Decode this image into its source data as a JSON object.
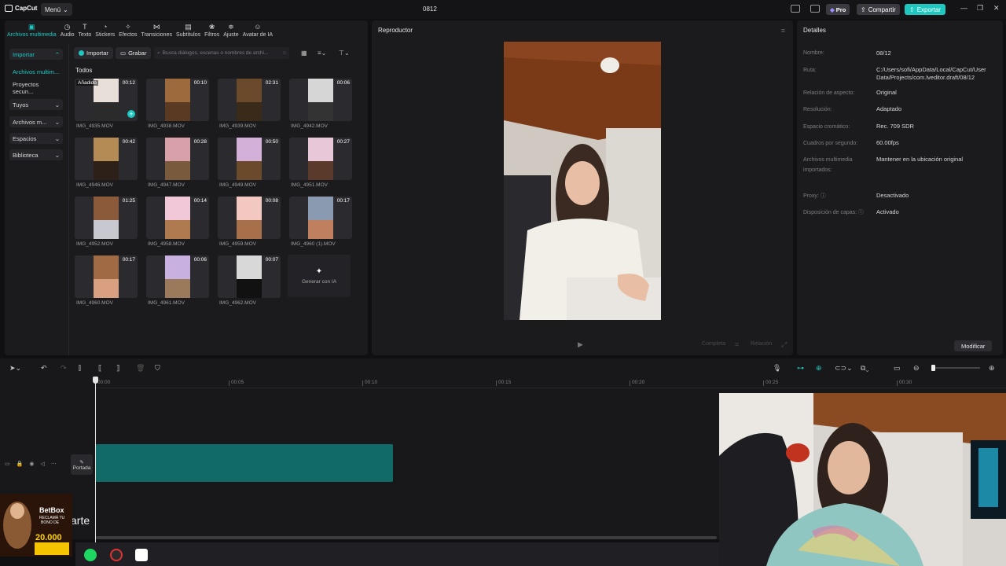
{
  "app": {
    "logo_text": "CapCut",
    "menu_label": "Menú",
    "project_title": "0812",
    "pro_label": "Pro",
    "share_label": "Compartir",
    "export_label": "Exportar"
  },
  "tool_tabs": [
    {
      "label": "Archivos multimedia",
      "icon": "media-icon",
      "glyph": "▣"
    },
    {
      "label": "Audio",
      "icon": "audio-icon",
      "glyph": "◷"
    },
    {
      "label": "Texto",
      "icon": "text-icon",
      "glyph": "T"
    },
    {
      "label": "Stickers",
      "icon": "sticker-icon",
      "glyph": "◔"
    },
    {
      "label": "Efectos",
      "icon": "effects-icon",
      "glyph": "✧"
    },
    {
      "label": "Transiciones",
      "icon": "transition-icon",
      "glyph": "⋈"
    },
    {
      "label": "Subtítulos",
      "icon": "subtitles-icon",
      "glyph": "▤"
    },
    {
      "label": "Filtros",
      "icon": "filters-icon",
      "glyph": "❀"
    },
    {
      "label": "Ajuste",
      "icon": "adjust-icon",
      "glyph": "≑"
    },
    {
      "label": "Avatar de IA",
      "icon": "avatar-icon",
      "glyph": "☺"
    }
  ],
  "sidebar": {
    "items": [
      {
        "label": "Importar"
      },
      {
        "label": "Archivos multim..."
      },
      {
        "label": "Proyectos secun..."
      },
      {
        "label": "Tuyos"
      },
      {
        "label": "Archivos m..."
      },
      {
        "label": "Espacios"
      },
      {
        "label": "Biblioteca"
      }
    ]
  },
  "media_toolbar": {
    "import_label": "Importar",
    "record_label": "Grabar",
    "search_placeholder": "Busca diálogos, escenas o nombres de archi..."
  },
  "all_label": "Todos",
  "added_label": "Añadido",
  "media_items": [
    {
      "name": "IMG_4935.MOV",
      "duration": "00:12"
    },
    {
      "name": "IMG_4938.MOV",
      "duration": "00:10"
    },
    {
      "name": "IMG_4939.MOV",
      "duration": "02:31"
    },
    {
      "name": "IMG_4942.MOV",
      "duration": "00:06"
    },
    {
      "name": "IMG_4946.MOV",
      "duration": "00:42"
    },
    {
      "name": "IMG_4947.MOV",
      "duration": "00:28"
    },
    {
      "name": "IMG_4949.MOV",
      "duration": "00:50"
    },
    {
      "name": "IMG_4951.MOV",
      "duration": "00:27"
    },
    {
      "name": "IMG_4952.MOV",
      "duration": "01:25"
    },
    {
      "name": "IMG_4958.MOV",
      "duration": "00:14"
    },
    {
      "name": "IMG_4959.MOV",
      "duration": "00:08"
    },
    {
      "name": "IMG_4960 (1).MOV",
      "duration": "00:17"
    },
    {
      "name": "IMG_4960.MOV",
      "duration": "00:17"
    },
    {
      "name": "IMG_4961.MOV",
      "duration": "00:06"
    },
    {
      "name": "IMG_4962.MOV",
      "duration": "00:07"
    }
  ],
  "generate_ai_label": "Generar con IA",
  "player": {
    "title": "Reproductor",
    "zoom_label": "Completa",
    "ratio_label": "Relación"
  },
  "details": {
    "title": "Detalles",
    "rows": [
      {
        "key": "Nombre:",
        "value": "08/12"
      },
      {
        "key": "Ruta:",
        "value": "C:/Users/sofi/AppData/Local/CapCut/User Data/Projects/com.lveditor.draft/08/12"
      },
      {
        "key": "Relación de aspecto:",
        "value": "Original"
      },
      {
        "key": "Resolución:",
        "value": "Adaptado"
      },
      {
        "key": "Espacio cromático:",
        "value": "Rec. 709 SDR"
      },
      {
        "key": "Cuadros por segundo:",
        "value": "60.00fps"
      },
      {
        "key": "Archivos multimedia importados:",
        "value": "Mantener en la ubicación original"
      },
      {
        "key": "Proxy:",
        "value": "Desactivado"
      },
      {
        "key": "Disposición de capas:",
        "value": "Activado"
      }
    ],
    "modify_label": "Modificar"
  },
  "timeline": {
    "ticks": [
      "00:00",
      "00:05",
      "00:10",
      "00:15",
      "00:20",
      "00:25",
      "00:30"
    ],
    "cover_label": "Portada"
  },
  "overlay": {
    "ad_brand": "BetBox",
    "ad_line1": "RECLAMÁ TU",
    "ad_line2": "BONO DE",
    "ad_amount": "20.000",
    "caption_fragment": "arte"
  },
  "colors": {
    "accent": "#1fc7c1",
    "clip": "#116a68"
  }
}
